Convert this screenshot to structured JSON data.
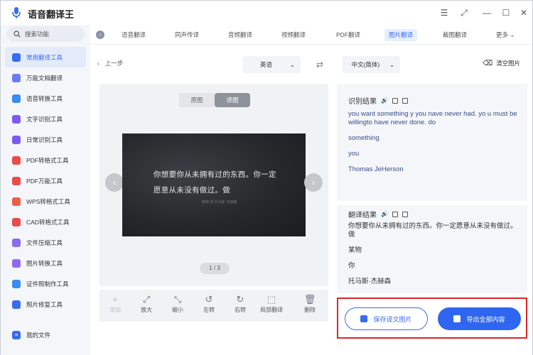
{
  "app": {
    "title": "语音翻译王"
  },
  "window_controls": {
    "menu": "☰",
    "restore_small": "⤢",
    "minimize": "—",
    "maximize": "☐",
    "close": "✕"
  },
  "sidebar": {
    "search_label": "搜索功能",
    "items": [
      {
        "label": "常用翻译工具",
        "icon": "translate-icon",
        "color": "#3a6cf0",
        "active": true
      },
      {
        "label": "万能文档翻译",
        "icon": "document-translate-icon",
        "color": "#6d7bf0"
      },
      {
        "label": "语音转换工具",
        "icon": "voice-convert-icon",
        "color": "#3a8cf0"
      },
      {
        "label": "文字识别工具",
        "icon": "text-recognize-icon",
        "color": "#7b5cf0"
      },
      {
        "label": "日常识别工具",
        "icon": "daily-recognize-icon",
        "color": "#7b5cf0"
      },
      {
        "label": "PDF转格式工具",
        "icon": "pdf-convert-icon",
        "color": "#e84c4c"
      },
      {
        "label": "PDF万能工具",
        "icon": "pdf-tools-icon",
        "color": "#e84c4c"
      },
      {
        "label": "WPS转格式工具",
        "icon": "wps-convert-icon",
        "color": "#e8604c"
      },
      {
        "label": "CAD转格式工具",
        "icon": "cad-convert-icon",
        "color": "#e84c4c"
      },
      {
        "label": "文件压缩工具",
        "icon": "compress-icon",
        "color": "#8a6cf0"
      },
      {
        "label": "图片转换工具",
        "icon": "image-convert-icon",
        "color": "#8a6cf0"
      },
      {
        "label": "证件照制作工具",
        "icon": "id-photo-icon",
        "color": "#3a8cf0"
      },
      {
        "label": "照片修复工具",
        "icon": "photo-repair-icon",
        "color": "#3a6cf0"
      }
    ],
    "bottom_label": "我的文件"
  },
  "tabs": {
    "items": [
      {
        "label": "语音翻译"
      },
      {
        "label": "同声传译"
      },
      {
        "label": "音频翻译"
      },
      {
        "label": "视频翻译"
      },
      {
        "label": "PDF翻译"
      },
      {
        "label": "图片翻译",
        "active": true
      },
      {
        "label": "截图翻译"
      }
    ],
    "more_label": "更多"
  },
  "toolbar": {
    "back_label": "上一步",
    "source_lang": "英语",
    "target_lang": "中文(简体)",
    "clear_label": "清空图片"
  },
  "preview": {
    "toggle_original": "原图",
    "toggle_translated": "译图",
    "image_line1": "你想要你从未拥有过的东西。你一定",
    "image_line2": "愿意从未没有做过。做",
    "image_faint": "某物      你     托马斯·杰赫森",
    "page_indicator": "1 / 3"
  },
  "tools": [
    {
      "label": "添加",
      "icon": "add-icon",
      "glyph": "+",
      "disabled": true
    },
    {
      "label": "放大",
      "icon": "zoom-in-icon",
      "glyph": "⤢"
    },
    {
      "label": "缩小",
      "icon": "zoom-out-icon",
      "glyph": "⤡"
    },
    {
      "label": "左转",
      "icon": "rotate-left-icon",
      "glyph": "↺"
    },
    {
      "label": "右转",
      "icon": "rotate-right-icon",
      "glyph": "↻"
    },
    {
      "label": "局部翻译",
      "icon": "partial-translate-icon",
      "glyph": "⬚"
    },
    {
      "label": "删除",
      "icon": "delete-icon",
      "glyph": "🗑"
    }
  ],
  "results": {
    "recognize_title": "识别结果",
    "recognize_lines": [
      "you want something y you nave never had. yo u must be willingto have never done. do",
      "something",
      "you",
      "Thomas JeHerson"
    ],
    "translate_title": "翻译结果",
    "translate_lines": [
      "你想要你从未拥有过的东西。你一定愿意从未没有做过。做",
      "某物",
      "你",
      "托马斯·杰赫森"
    ]
  },
  "actions": {
    "save_label": "保存译文图片",
    "export_label": "导出全部内容"
  },
  "colors": {
    "accent": "#3a6cf0",
    "highlight_border": "#d9252b"
  }
}
